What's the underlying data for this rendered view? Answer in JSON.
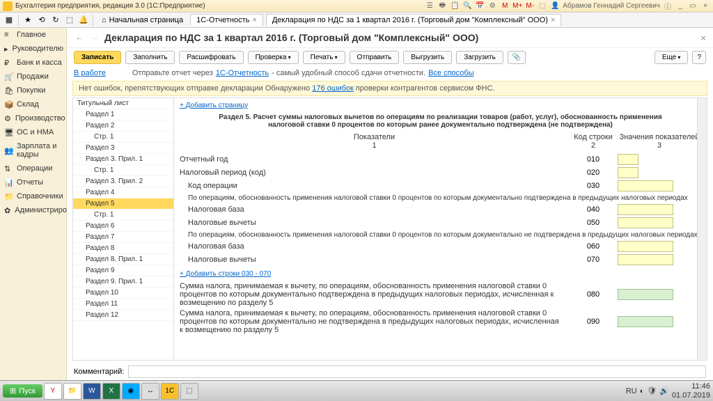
{
  "window": {
    "title": "Бухгалтерия предприятия, редакция 3.0  (1С:Предприятие)",
    "user": "Абрамов Геннадий Сергеевич"
  },
  "toolbar_icons": [
    "☆",
    "⟲",
    "↻",
    "⬚",
    "🔔"
  ],
  "tabs": {
    "home": "Начальная страница",
    "t1": "1С-Отчетность",
    "t2": "Декларация по НДС за 1 квартал 2016 г. (Торговый дом \"Комплексный\" ООО)"
  },
  "leftnav": [
    {
      "icon": "≡",
      "label": "Главное"
    },
    {
      "icon": "▸",
      "label": "Руководителю"
    },
    {
      "icon": "₽",
      "label": "Банк и касса"
    },
    {
      "icon": "🛒",
      "label": "Продажи"
    },
    {
      "icon": "🛍",
      "label": "Покупки"
    },
    {
      "icon": "📦",
      "label": "Склад"
    },
    {
      "icon": "⚙",
      "label": "Производство"
    },
    {
      "icon": "🖥",
      "label": "ОС и НМА"
    },
    {
      "icon": "👥",
      "label": "Зарплата и кадры"
    },
    {
      "icon": "⇅",
      "label": "Операции"
    },
    {
      "icon": "📊",
      "label": "Отчеты"
    },
    {
      "icon": "📁",
      "label": "Справочники"
    },
    {
      "icon": "✿",
      "label": "Администрирование"
    }
  ],
  "page": {
    "title": "Декларация по НДС за 1 квартал 2016 г. (Торговый дом \"Комплексный\" ООО)",
    "buttons": {
      "record": "Записать",
      "fill": "Заполнить",
      "decode": "Расшифровать",
      "check": "Проверка",
      "print": "Печать",
      "send": "Отправить",
      "unload": "Выгрузить",
      "load": "Загрузить",
      "more": "Еще"
    },
    "status": {
      "inwork": "В работе",
      "text1": "Отправьте отчет через ",
      "link1": "1С-Отчетность",
      "text2": " - самый удобный способ сдачи отчетности. ",
      "link2": "Все способы"
    },
    "warn": {
      "t1": "Нет ошибок, препятствующих отправке декларации Обнаружено ",
      "link": "176 ошибок",
      "t2": " проверки контрагентов сервисом ФНС."
    }
  },
  "sections": [
    {
      "label": "Титульный лист"
    },
    {
      "label": "Раздел 1",
      "indent": true
    },
    {
      "label": "Раздел 2",
      "indent": true
    },
    {
      "label": "Стр. 1",
      "indent": true,
      "deep": true
    },
    {
      "label": "Раздел 3",
      "indent": true
    },
    {
      "label": "Раздел 3. Прил. 1",
      "indent": true
    },
    {
      "label": "Стр. 1",
      "indent": true,
      "deep": true
    },
    {
      "label": "Раздел 3. Прил. 2",
      "indent": true
    },
    {
      "label": "Раздел 4",
      "indent": true
    },
    {
      "label": "Раздел 5",
      "indent": true,
      "selected": true
    },
    {
      "label": "Стр. 1",
      "indent": true,
      "deep": true
    },
    {
      "label": "Раздел 6",
      "indent": true
    },
    {
      "label": "Раздел 7",
      "indent": true
    },
    {
      "label": "Раздел 8",
      "indent": true
    },
    {
      "label": "Раздел 8. Прил. 1",
      "indent": true
    },
    {
      "label": "Раздел 9",
      "indent": true
    },
    {
      "label": "Раздел 9. Прил. 1",
      "indent": true
    },
    {
      "label": "Раздел 10",
      "indent": true
    },
    {
      "label": "Раздел 11",
      "indent": true
    },
    {
      "label": "Раздел 12",
      "indent": true
    }
  ],
  "form": {
    "add_page": "Добавить страницу",
    "title": "Раздел 5. Расчет суммы налоговых вычетов по операциям по реализации товаров (работ, услуг), обоснованность применения налоговой ставки 0 процентов по которым ранее документально подтверждена (не подтверждена)",
    "col1": "Показатели",
    "col2": "Код строки",
    "col3": "Значения показателей",
    "n1": "1",
    "n2": "2",
    "n3": "3",
    "rows": {
      "r010": {
        "label": "Отчетный год",
        "code": "010",
        "small": true
      },
      "r020": {
        "label": "Налоговый период (код)",
        "code": "020",
        "small": true
      },
      "r030": {
        "label": "Код операции",
        "code": "030",
        "indent": true
      },
      "h1": "По операциям, обоснованность применения налоговой ставки 0 процентов по которым документально подтверждена в предыдущих налоговых периодах",
      "r040": {
        "label": "Налоговая база",
        "code": "040",
        "indent": true
      },
      "r050": {
        "label": "Налоговые вычеты",
        "code": "050",
        "indent": true
      },
      "h2": "По операциям, обоснованность применения налоговой ставки 0 процентов по которым документально не подтверждена в предыдущих налоговых периодах",
      "r060": {
        "label": "Налоговая база",
        "code": "060",
        "indent": true
      },
      "r070": {
        "label": "Налоговые вычеты",
        "code": "070",
        "indent": true
      },
      "addlines": "Добавить строки 030 - 070",
      "r080": {
        "label": "Сумма налога, принимаемая к вычету, по операциям, обоснованность применения налоговой ставки 0 процентов по которым документально подтверждена в предыдущих налоговых периодах, исчисленная к возмещению по разделу 5",
        "code": "080",
        "green": true
      },
      "r090": {
        "label": "Сумма налога, принимаемая к вычету, по операциям, обоснованность применения налоговой ставки 0 процентов по которым документально не подтверждена в предыдущих налоговых периодах, исчисленная к возмещению по разделу 5",
        "code": "090",
        "green": true
      }
    }
  },
  "comment_label": "Комментарий:",
  "taskbar": {
    "start": "Пуск",
    "lang": "RU",
    "time": "11:46",
    "date": "01.07.2019"
  }
}
